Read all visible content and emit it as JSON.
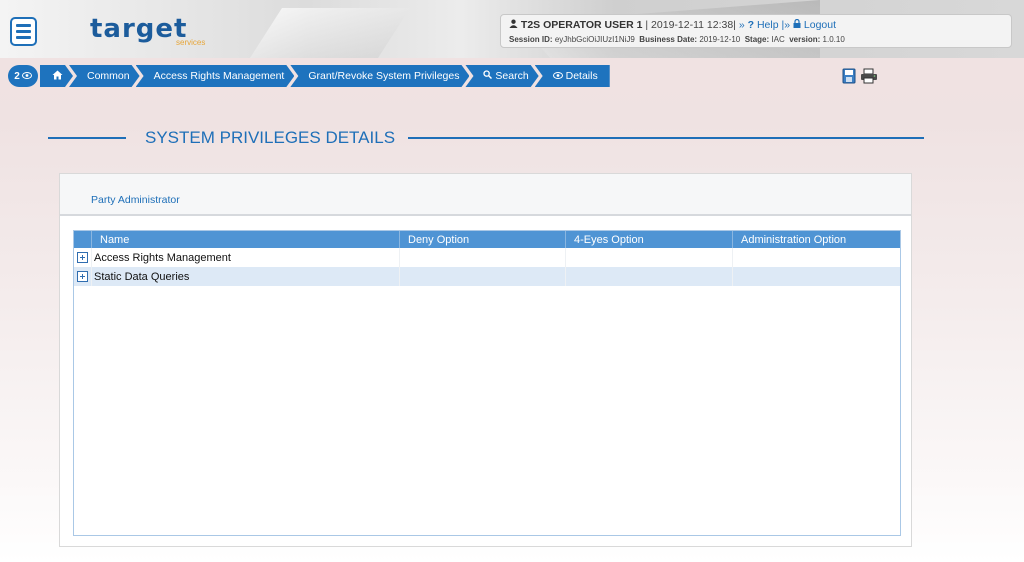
{
  "header": {
    "logo_main": "target",
    "logo_sub": "services",
    "user": "T2S OPERATOR USER 1",
    "datetime": "| 2019-12-11 12:38|",
    "help_prefix": "»",
    "help": "Help",
    "logout_prefix": "|»",
    "logout": "Logout",
    "session_label": "Session ID:",
    "session_value": "eyJhbGciOiJIUzI1NiJ9",
    "business_date_label": "Business Date:",
    "business_date_value": "2019-12-10",
    "stage_label": "Stage:",
    "stage_value": "IAC",
    "version_label": "version:",
    "version_value": "1.0.10"
  },
  "breadcrumb": {
    "badge": "2",
    "items": [
      "Common",
      "Access Rights Management",
      "Grant/Revoke System Privileges",
      "Search",
      "Details"
    ]
  },
  "page": {
    "title": "SYSTEM PRIVILEGES DETAILS",
    "section": "Party Administrator"
  },
  "table": {
    "columns": [
      "Name",
      "Deny Option",
      "4-Eyes Option",
      "Administration Option"
    ],
    "rows": [
      {
        "name": "Access Rights Management",
        "deny": "",
        "four_eyes": "",
        "admin": ""
      },
      {
        "name": "Static Data Queries",
        "deny": "",
        "four_eyes": "",
        "admin": ""
      }
    ]
  },
  "colors": {
    "accent": "#1e73be",
    "grid_header": "#4f94d4",
    "row_alt": "#dde9f6"
  }
}
